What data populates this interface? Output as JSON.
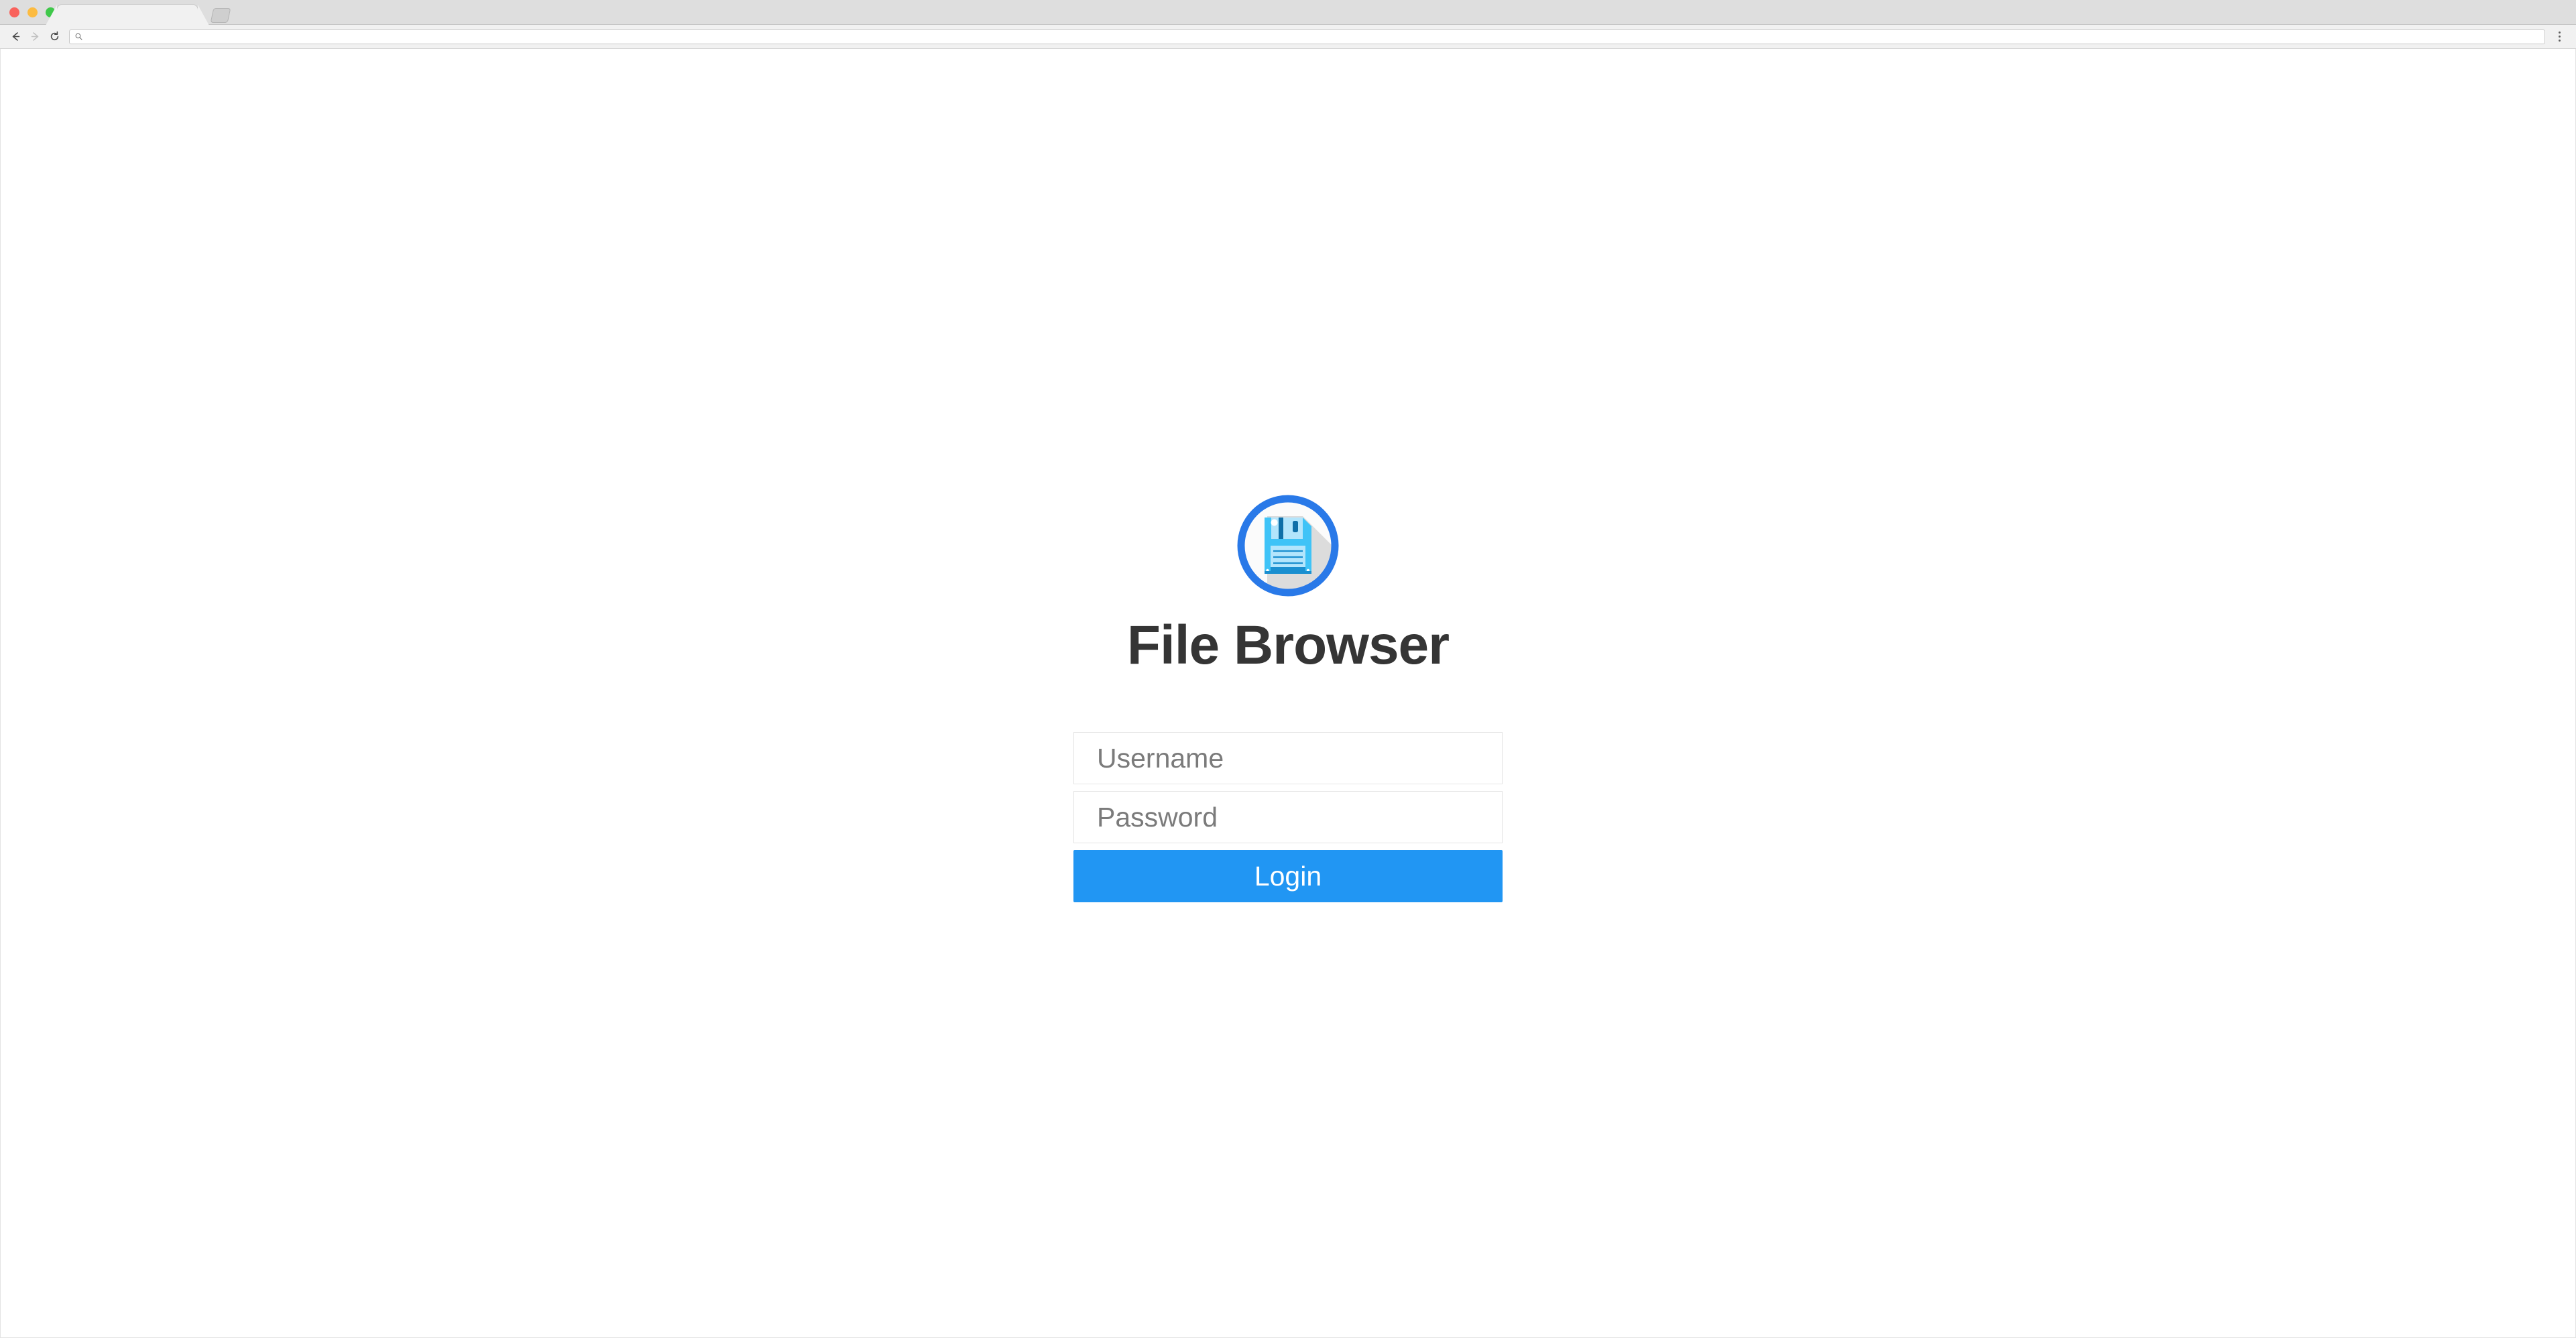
{
  "browser": {
    "traffic_lights": [
      {
        "name": "close",
        "color": "#f9625c"
      },
      {
        "name": "minimize",
        "color": "#fcbb40"
      },
      {
        "name": "maximize",
        "color": "#3fc84a"
      }
    ],
    "tab": {
      "title": "",
      "new_tab_label": ""
    },
    "toolbar": {
      "back_icon": "back-arrow-icon",
      "forward_icon": "forward-arrow-icon",
      "reload_icon": "reload-icon",
      "url_value": "",
      "url_placeholder": "",
      "search_icon": "search-icon",
      "menu_icon": "three-dot-menu-icon"
    }
  },
  "page": {
    "logo": {
      "icon_name": "floppy-disk-logo",
      "ring_color": "#2979e8",
      "disk_color": "#3fc3f7",
      "disk_dark": "#0f6fa8",
      "label_color": "#b3e5fc",
      "shadow_color": "#dcdcdc"
    },
    "title": "File Browser",
    "form": {
      "username_placeholder": "Username",
      "username_value": "",
      "password_placeholder": "Password",
      "password_value": "",
      "login_label": "Login",
      "accent_color": "#2196f3"
    }
  }
}
